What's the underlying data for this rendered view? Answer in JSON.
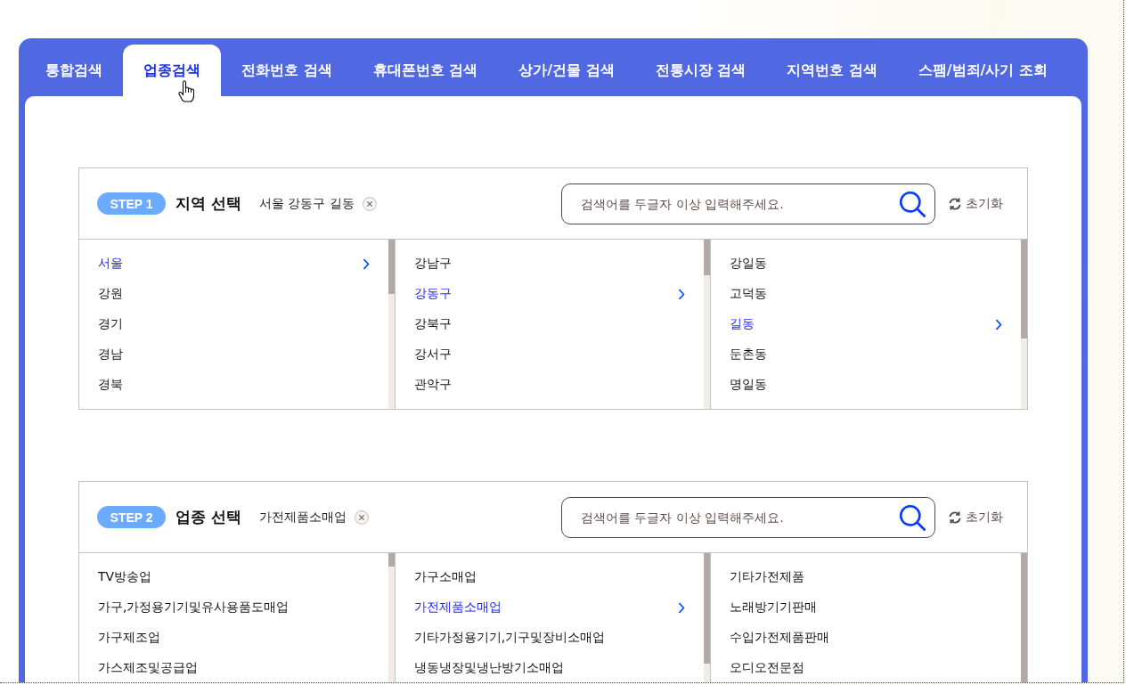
{
  "tabs": [
    {
      "label": "통합검색",
      "selected": false
    },
    {
      "label": "업종검색",
      "selected": true
    },
    {
      "label": "전화번호 검색",
      "selected": false
    },
    {
      "label": "휴대폰번호 검색",
      "selected": false
    },
    {
      "label": "상가/건물 검색",
      "selected": false
    },
    {
      "label": "전통시장 검색",
      "selected": false
    },
    {
      "label": "지역번호 검색",
      "selected": false
    },
    {
      "label": "스팸/범죄/사기 조회",
      "selected": false
    }
  ],
  "steps": [
    {
      "badge": "STEP 1",
      "title": "지역 선택",
      "selection": "서울 강동구 길동",
      "search": {
        "placeholder": "검색어를 두글자 이상 입력해주세요."
      },
      "reset": "초기화",
      "columns": [
        {
          "items": [
            {
              "label": "서울",
              "selected": true
            },
            {
              "label": "강원",
              "selected": false
            },
            {
              "label": "경기",
              "selected": false
            },
            {
              "label": "경남",
              "selected": false
            },
            {
              "label": "경북",
              "selected": false
            }
          ]
        },
        {
          "items": [
            {
              "label": "강남구",
              "selected": false
            },
            {
              "label": "강동구",
              "selected": true
            },
            {
              "label": "강북구",
              "selected": false
            },
            {
              "label": "강서구",
              "selected": false
            },
            {
              "label": "관악구",
              "selected": false
            }
          ]
        },
        {
          "items": [
            {
              "label": "강일동",
              "selected": false
            },
            {
              "label": "고덕동",
              "selected": false
            },
            {
              "label": "길동",
              "selected": true
            },
            {
              "label": "둔촌동",
              "selected": false
            },
            {
              "label": "명일동",
              "selected": false
            }
          ]
        }
      ]
    },
    {
      "badge": "STEP 2",
      "title": "업종 선택",
      "selection": "가전제품소매업",
      "search": {
        "placeholder": "검색어를 두글자 이상 입력해주세요."
      },
      "reset": "초기화",
      "columns": [
        {
          "items": [
            {
              "label": "TV방송업",
              "selected": false
            },
            {
              "label": "가구,가정용기기및유사용품도매업",
              "selected": false
            },
            {
              "label": "가구제조업",
              "selected": false
            },
            {
              "label": "가스제조및공급업",
              "selected": false
            }
          ]
        },
        {
          "items": [
            {
              "label": "가구소매업",
              "selected": false
            },
            {
              "label": "가전제품소매업",
              "selected": true
            },
            {
              "label": "기타가정용기기,기구및장비소매업",
              "selected": false
            },
            {
              "label": "냉동냉장및냉난방기소매업",
              "selected": false
            }
          ]
        },
        {
          "items": [
            {
              "label": "기타가전제품",
              "selected": false
            },
            {
              "label": "노래방기기판매",
              "selected": false
            },
            {
              "label": "수입가전제품판매",
              "selected": false
            },
            {
              "label": "오디오전문점",
              "selected": false
            }
          ]
        }
      ]
    }
  ]
}
